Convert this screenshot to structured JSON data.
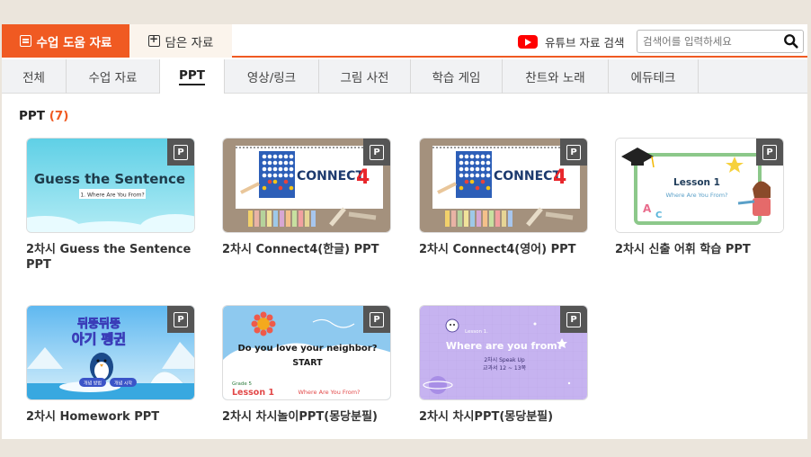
{
  "header": {
    "tabs": [
      {
        "label": "수업 도움 자료",
        "icon": "list-icon",
        "active": true
      },
      {
        "label": "담은 자료",
        "icon": "plus-box-icon",
        "active": false
      }
    ],
    "youtube_label": "유튜브 자료 검색",
    "search_placeholder": "검색어를 입력하세요"
  },
  "categories": [
    "전체",
    "수업 자료",
    "PPT",
    "영상/링크",
    "그림 사전",
    "학습 게임",
    "찬트와 노래",
    "에듀테크"
  ],
  "active_category": "PPT",
  "section": {
    "title": "PPT",
    "count": "(7)"
  },
  "badge_letter": "P",
  "cards": [
    {
      "title": "2차시 Guess the Sentence PPT",
      "thumb_text": [
        "Guess the Sentence",
        "1. Where Are You From?"
      ]
    },
    {
      "title": "2차시 Connect4(한글) PPT",
      "thumb_text": [
        "CONNECT",
        "4"
      ]
    },
    {
      "title": "2차시 Connect4(영어) PPT",
      "thumb_text": [
        "CONNECT",
        "4"
      ]
    },
    {
      "title": "2차시 신출 어휘 학습 PPT",
      "thumb_text": [
        "Lesson 1",
        "Where Are You From?",
        "A",
        "C"
      ]
    },
    {
      "title": "2차시 Homework PPT",
      "thumb_text": [
        "뒤뚱뒤뚱",
        "아기 펭귄",
        "개념 방법",
        "개념 시작"
      ]
    },
    {
      "title": "2차시 차시놀이PPT(몽당분필)",
      "thumb_text": [
        "Do you love your neighbor?",
        "START",
        "Grade 5",
        "Lesson 1",
        "Where Are You From?"
      ]
    },
    {
      "title": "2차시 차시PPT(몽당분필)",
      "thumb_text": [
        "Lesson 1.",
        "Where are you from?",
        "2차시 Speak Up",
        "교과서 12 ~ 13쪽"
      ]
    }
  ],
  "colors": {
    "accent": "#f05a22",
    "count": "#f05a22",
    "youtube": "#ff0000"
  }
}
